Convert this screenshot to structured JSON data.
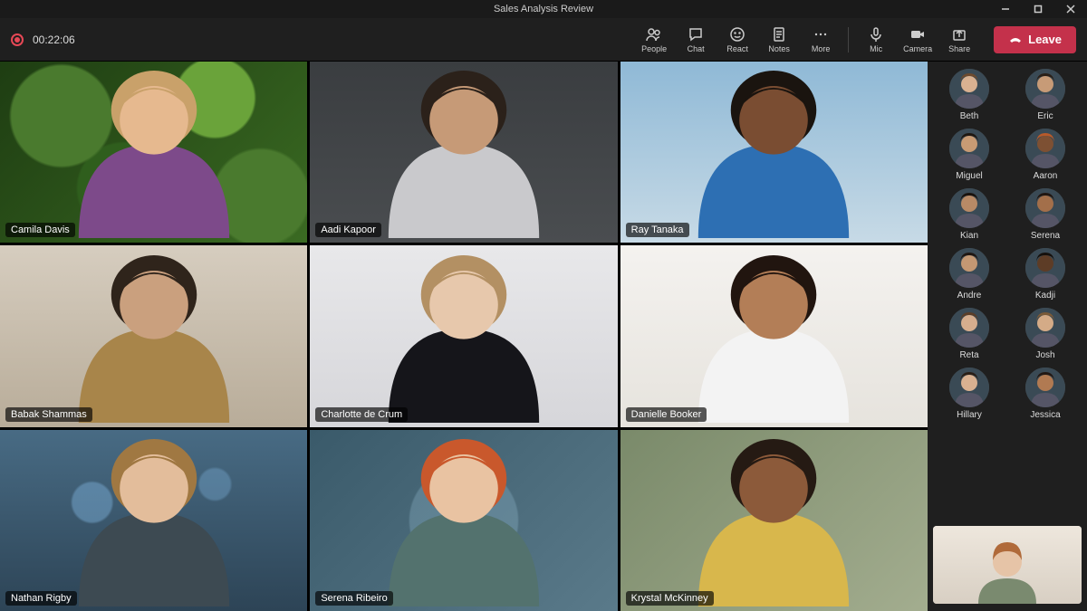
{
  "window": {
    "title": "Sales Analysis Review"
  },
  "recording": {
    "elapsed": "00:22:06"
  },
  "toolbar": {
    "people": "People",
    "chat": "Chat",
    "react": "React",
    "notes": "Notes",
    "more": "More",
    "mic": "Mic",
    "camera": "Camera",
    "share": "Share",
    "leave": "Leave"
  },
  "participants_grid": [
    {
      "name": "Camila Davis",
      "style": "avatar",
      "bg": "foliage",
      "skin": "#e6b98f",
      "hair": "#c9a16a",
      "clothes": "#7d4a8a"
    },
    {
      "name": "Aadi Kapoor",
      "style": "video",
      "bg": "office-dim",
      "skin": "#c69a77",
      "hair": "#2b211a",
      "clothes": "#c9c9cc"
    },
    {
      "name": "Ray Tanaka",
      "style": "avatar",
      "bg": "sky",
      "skin": "#7a4d32",
      "hair": "#1a140f",
      "clothes": "#2d6fb3"
    },
    {
      "name": "Babak Shammas",
      "style": "video",
      "bg": "room-warm",
      "skin": "#caa07e",
      "hair": "#2f241b",
      "clothes": "#a8854a"
    },
    {
      "name": "Charlotte de Crum",
      "style": "video",
      "bg": "studio",
      "skin": "#e7c8ac",
      "hair": "#b39063",
      "clothes": "#15151a"
    },
    {
      "name": "Danielle Booker",
      "style": "video",
      "bg": "bright",
      "skin": "#b37e57",
      "hair": "#21150f",
      "clothes": "#f3f3f3"
    },
    {
      "name": "Nathan Rigby",
      "style": "video",
      "bg": "blue-bokeh",
      "skin": "#e3bd9b",
      "hair": "#a07842",
      "clothes": "#3d4a52"
    },
    {
      "name": "Serena Ribeiro",
      "style": "avatar",
      "bg": "circuit",
      "skin": "#e9c3a2",
      "hair": "#c9582c",
      "clothes": "#53726e"
    },
    {
      "name": "Krystal McKinney",
      "style": "avatar",
      "bg": "hex-plant",
      "skin": "#8c5a3a",
      "hair": "#251a13",
      "clothes": "#d8b74c"
    }
  ],
  "roster": [
    {
      "name": "Beth",
      "skin": "#d9b191",
      "hair": "#6d4a2e"
    },
    {
      "name": "Eric",
      "skin": "#c79b77",
      "hair": "#2a1f17"
    },
    {
      "name": "Miguel",
      "skin": "#c89b74",
      "hair": "#1f1812"
    },
    {
      "name": "Aaron",
      "skin": "#7d5033",
      "hair": "#b85a2a"
    },
    {
      "name": "Kian",
      "skin": "#b88a66",
      "hair": "#1a130e"
    },
    {
      "name": "Serena",
      "skin": "#a36f4a",
      "hair": "#201611"
    },
    {
      "name": "Andre",
      "skin": "#c49873",
      "hair": "#201712"
    },
    {
      "name": "Kadji",
      "skin": "#5d3c26",
      "hair": "#15100c"
    },
    {
      "name": "Reta",
      "skin": "#d6ae8e",
      "hair": "#5b3e28"
    },
    {
      "name": "Josh",
      "skin": "#d4ab87",
      "hair": "#7a5a38"
    },
    {
      "name": "Hillary",
      "skin": "#d9b191",
      "hair": "#2a1f17"
    },
    {
      "name": "Jessica",
      "skin": "#b17a52",
      "hair": "#221813"
    }
  ],
  "self": {
    "skin": "#e6c4a7",
    "hair": "#b06a3a"
  }
}
